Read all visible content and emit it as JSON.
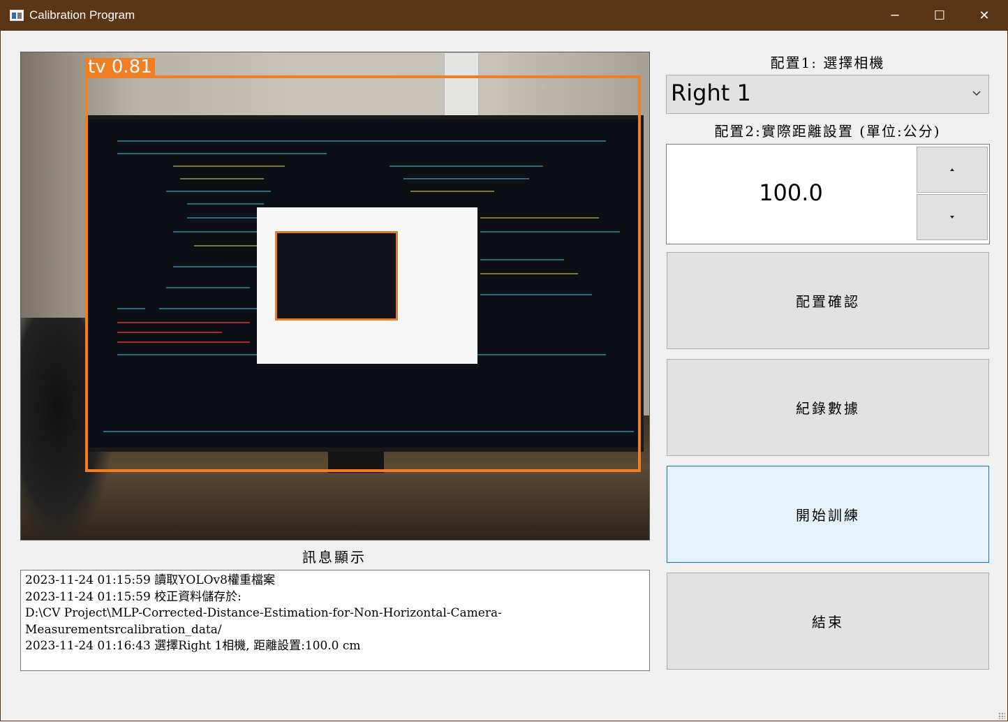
{
  "window": {
    "title": "Calibration Program",
    "minimize_glyph": "─",
    "maximize_glyph": "☐",
    "close_glyph": "✕"
  },
  "camera_view": {
    "detection_label": "tv 0.81"
  },
  "config": {
    "camera_label": "配置1: 選擇相機",
    "camera_selected": "Right 1",
    "distance_label": "配置2:實際距離設置 (單位:公分)",
    "distance_value": "100.0"
  },
  "buttons": {
    "confirm": "配置確認",
    "record": "紀錄數據",
    "train": "開始訓練",
    "exit": "結束"
  },
  "messages": {
    "title": "訊息顯示",
    "lines": [
      "2023-11-24 01:15:59 讀取YOLOv8權重檔案",
      "2023-11-24 01:15:59 校正資料儲存於:",
      "D:\\CV Project\\MLP-Corrected-Distance-Estimation-for-Non-Horizontal-Camera-",
      "Measurementsrcalibration_data/",
      "2023-11-24 01:16:43 選擇Right 1相機, 距離設置:100.0 cm"
    ]
  },
  "icons": {
    "app": "app-window-icon",
    "dropdown": "chevron-down-icon",
    "spin_up": "triangle-up-icon",
    "spin_down": "triangle-down-icon"
  },
  "colors": {
    "titlebar": "#5a3516",
    "detection_box": "#f07f23",
    "focus_border": "#0078d7",
    "focus_fill": "#e5f1fb"
  }
}
